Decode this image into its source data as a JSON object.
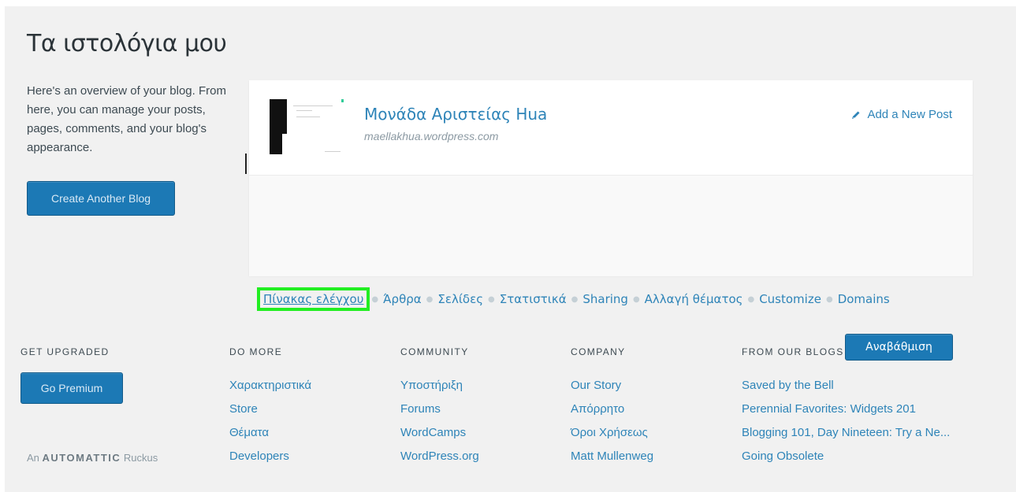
{
  "page": {
    "title": "Τα ιστολόγια μου",
    "intro": "Here's an overview of your blog. From here, you can manage your posts, pages, comments, and your blog's appearance.",
    "create_button": "Create Another Blog"
  },
  "blog": {
    "name": "Μονάδα Αριστείας Hua",
    "url": "maellakhua.wordpress.com",
    "add_post": "Add a New Post",
    "nav": [
      "Πίνακας ελέγχου",
      "Άρθρα",
      "Σελίδες",
      "Στατιστικά",
      "Sharing",
      "Αλλαγή θέματος",
      "Customize",
      "Domains"
    ],
    "upgrade_button": "Αναβάθμιση"
  },
  "footer": {
    "get_upgraded": {
      "heading": "GET UPGRADED",
      "button": "Go Premium"
    },
    "do_more": {
      "heading": "DO MORE",
      "links": [
        "Χαρακτηριστικά",
        "Store",
        "Θέματα",
        "Developers"
      ]
    },
    "community": {
      "heading": "COMMUNITY",
      "links": [
        "Υποστήριξη",
        "Forums",
        "WordCamps",
        "WordPress.org"
      ]
    },
    "company": {
      "heading": "COMPANY",
      "links": [
        "Our Story",
        "Απόρρητο",
        "Όροι Χρήσεως",
        "Matt Mullenweg"
      ]
    },
    "from_our_blogs": {
      "heading": "FROM OUR BLOGS",
      "links": [
        "Saved by the Bell",
        "Perennial Favorites: Widgets 201",
        "Blogging 101, Day Nineteen: Try a Ne...",
        "Going Obsolete"
      ]
    },
    "automattic": {
      "prefix": "An",
      "brand": "AUTOMATTIC",
      "suffix": "Ruckus"
    }
  },
  "colors": {
    "accent": "#2e84b8",
    "button": "#1c79b5",
    "highlight": "#22ee22",
    "background": "#f1f1f1"
  }
}
